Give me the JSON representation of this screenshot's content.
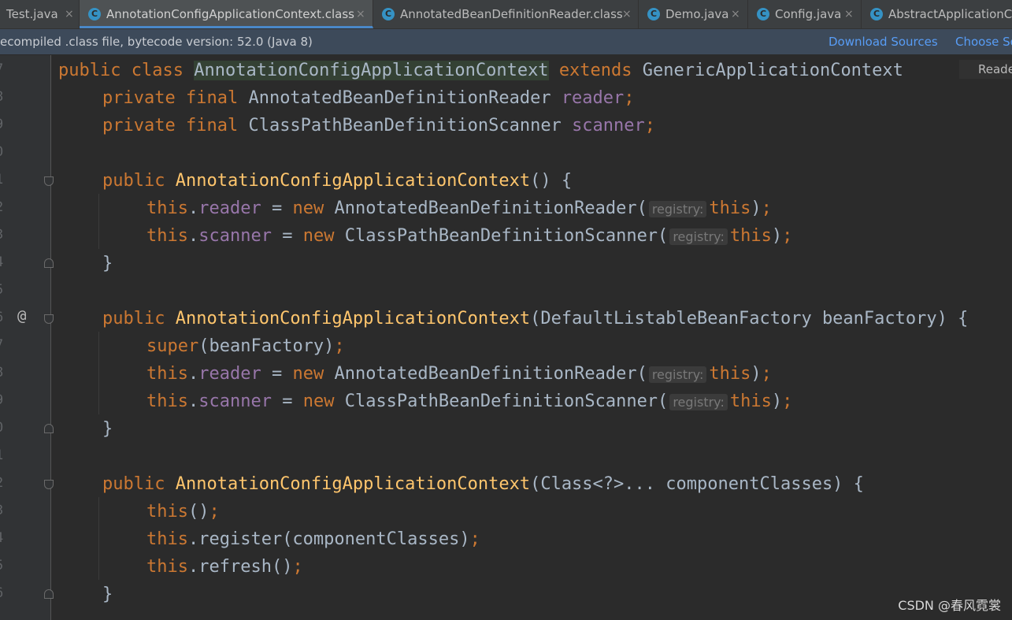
{
  "tabs": [
    {
      "label": "Test.java",
      "icon": "class-icon",
      "active": false
    },
    {
      "label": "AnnotationConfigApplicationContext.class",
      "icon": "class-icon",
      "active": true
    },
    {
      "label": "AnnotatedBeanDefinitionReader.class",
      "icon": "class-icon",
      "active": false
    },
    {
      "label": "Demo.java",
      "icon": "class-icon",
      "active": false
    },
    {
      "label": "Config.java",
      "icon": "class-icon",
      "active": false
    },
    {
      "label": "AbstractApplicationC",
      "icon": "class-icon",
      "active": false
    }
  ],
  "tab_close_glyph": "×",
  "banner": {
    "message": "ecompiled .class file, bytecode version: 52.0 (Java 8)",
    "download_sources": "Download Sources",
    "choose_sources": "Choose So"
  },
  "editor": {
    "reader_mode_label": "Reade",
    "line_numbers": [
      "7",
      "8",
      "9",
      "0",
      "1",
      "2",
      "3",
      "4",
      "5",
      "6",
      "7",
      "8",
      "9",
      "0",
      "1",
      "2",
      "3",
      "4",
      "5",
      "6"
    ],
    "override_marker": "@",
    "param_hint": "registry:",
    "code": {
      "l1": [
        "public",
        "class",
        "AnnotationConfigApplicationContext",
        "extends",
        "GenericApplicationContext"
      ],
      "l2": [
        "private",
        "final",
        "AnnotatedBeanDefinitionReader",
        "reader",
        ";"
      ],
      "l3": [
        "private",
        "final",
        "ClassPathBeanDefinitionScanner",
        "scanner",
        ";"
      ],
      "l5": [
        "public",
        "AnnotationConfigApplicationContext",
        "() {"
      ],
      "l6": [
        "this",
        ".",
        "reader",
        " = ",
        "new",
        "AnnotatedBeanDefinitionReader(",
        "this",
        ")",
        ";"
      ],
      "l7": [
        "this",
        ".",
        "scanner",
        " = ",
        "new",
        "ClassPathBeanDefinitionScanner(",
        "this",
        ")",
        ";"
      ],
      "l8": [
        "}"
      ],
      "l10": [
        "public",
        "AnnotationConfigApplicationContext",
        "(DefaultListableBeanFactory beanFactory) {"
      ],
      "l11": [
        "super",
        "(beanFactory)",
        ";"
      ],
      "l12": [
        "this",
        ".",
        "reader",
        " = ",
        "new",
        "AnnotatedBeanDefinitionReader(",
        "this",
        ")",
        ";"
      ],
      "l13": [
        "this",
        ".",
        "scanner",
        " = ",
        "new",
        "ClassPathBeanDefinitionScanner(",
        "this",
        ")",
        ";"
      ],
      "l14": [
        "}"
      ],
      "l16": [
        "public",
        "AnnotationConfigApplicationContext",
        "(Class<?>... componentClasses) {"
      ],
      "l17": [
        "this",
        "()",
        ";"
      ],
      "l18": [
        "this",
        ".register(componentClasses)",
        ";"
      ],
      "l19": [
        "this",
        ".refresh()",
        ";"
      ],
      "l20": [
        "}"
      ]
    }
  },
  "watermark": "CSDN @春风霓裳",
  "colors": {
    "keyword": "#cc7832",
    "method": "#ffc66d",
    "field": "#9876aa",
    "plain": "#a9b7c6",
    "background": "#2b2b2b",
    "link": "#589df6"
  }
}
